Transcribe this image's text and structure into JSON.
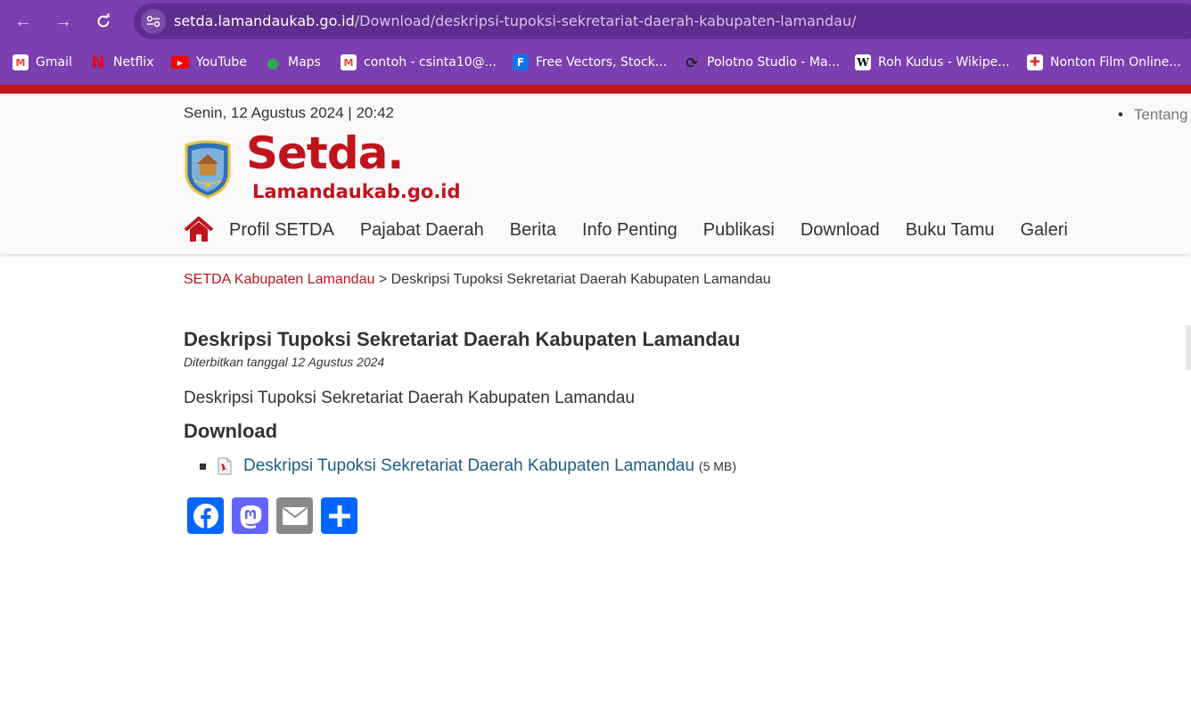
{
  "browser": {
    "url_domain": "setda.lamandaukab.go.id",
    "url_path": "/Download/deskripsi-tupoksi-sekretariat-daerah-kabupaten-lamandau/",
    "bookmarks": [
      {
        "label": "Gmail",
        "icon": "gmail-icon"
      },
      {
        "label": "Netflix",
        "icon": "netflix-icon"
      },
      {
        "label": "YouTube",
        "icon": "youtube-icon"
      },
      {
        "label": "Maps",
        "icon": "maps-icon"
      },
      {
        "label": "contoh - csinta10@...",
        "icon": "gmail-icon"
      },
      {
        "label": "Free Vectors, Stock...",
        "icon": "freepik-icon"
      },
      {
        "label": "Polotno Studio - Ma...",
        "icon": "polotno-icon"
      },
      {
        "label": "Roh Kudus - Wikipe...",
        "icon": "wikipedia-icon"
      },
      {
        "label": "Nonton Film Online...",
        "icon": "film-icon"
      }
    ]
  },
  "header": {
    "datetime": "Senin, 12 Agustus 2024  | 20:42",
    "top_link": "Tentang",
    "brand_main": "Setda.",
    "brand_sub": "Lamandaukab.go.id",
    "menu": [
      "Profil SETDA",
      "Pajabat Daerah",
      "Berita",
      "Info Penting",
      "Publikasi",
      "Download",
      "Buku Tamu",
      "Galeri"
    ]
  },
  "breadcrumb": {
    "home": "SETDA Kabupaten Lamandau",
    "separator": " > ",
    "current": "Deskripsi Tupoksi Sekretariat Daerah Kabupaten Lamandau"
  },
  "article": {
    "title": "Deskripsi Tupoksi Sekretariat Daerah Kabupaten Lamandau",
    "published": "Diterbitkan tanggal 12 Agustus 2024",
    "description": "Deskripsi Tupoksi Sekretariat Daerah Kabupaten Lamandau",
    "download_heading": "Download",
    "download_link": "Deskripsi Tupoksi Sekretariat Daerah Kabupaten Lamandau",
    "download_size": "(5 MB)"
  },
  "colors": {
    "accent_red": "#c0141c",
    "browser_purple": "#7b3fb0",
    "link_blue": "#1e5d86",
    "facebook": "#0866ff",
    "mastodon": "#6364ff",
    "email": "#888888",
    "share": "#0166ff"
  }
}
